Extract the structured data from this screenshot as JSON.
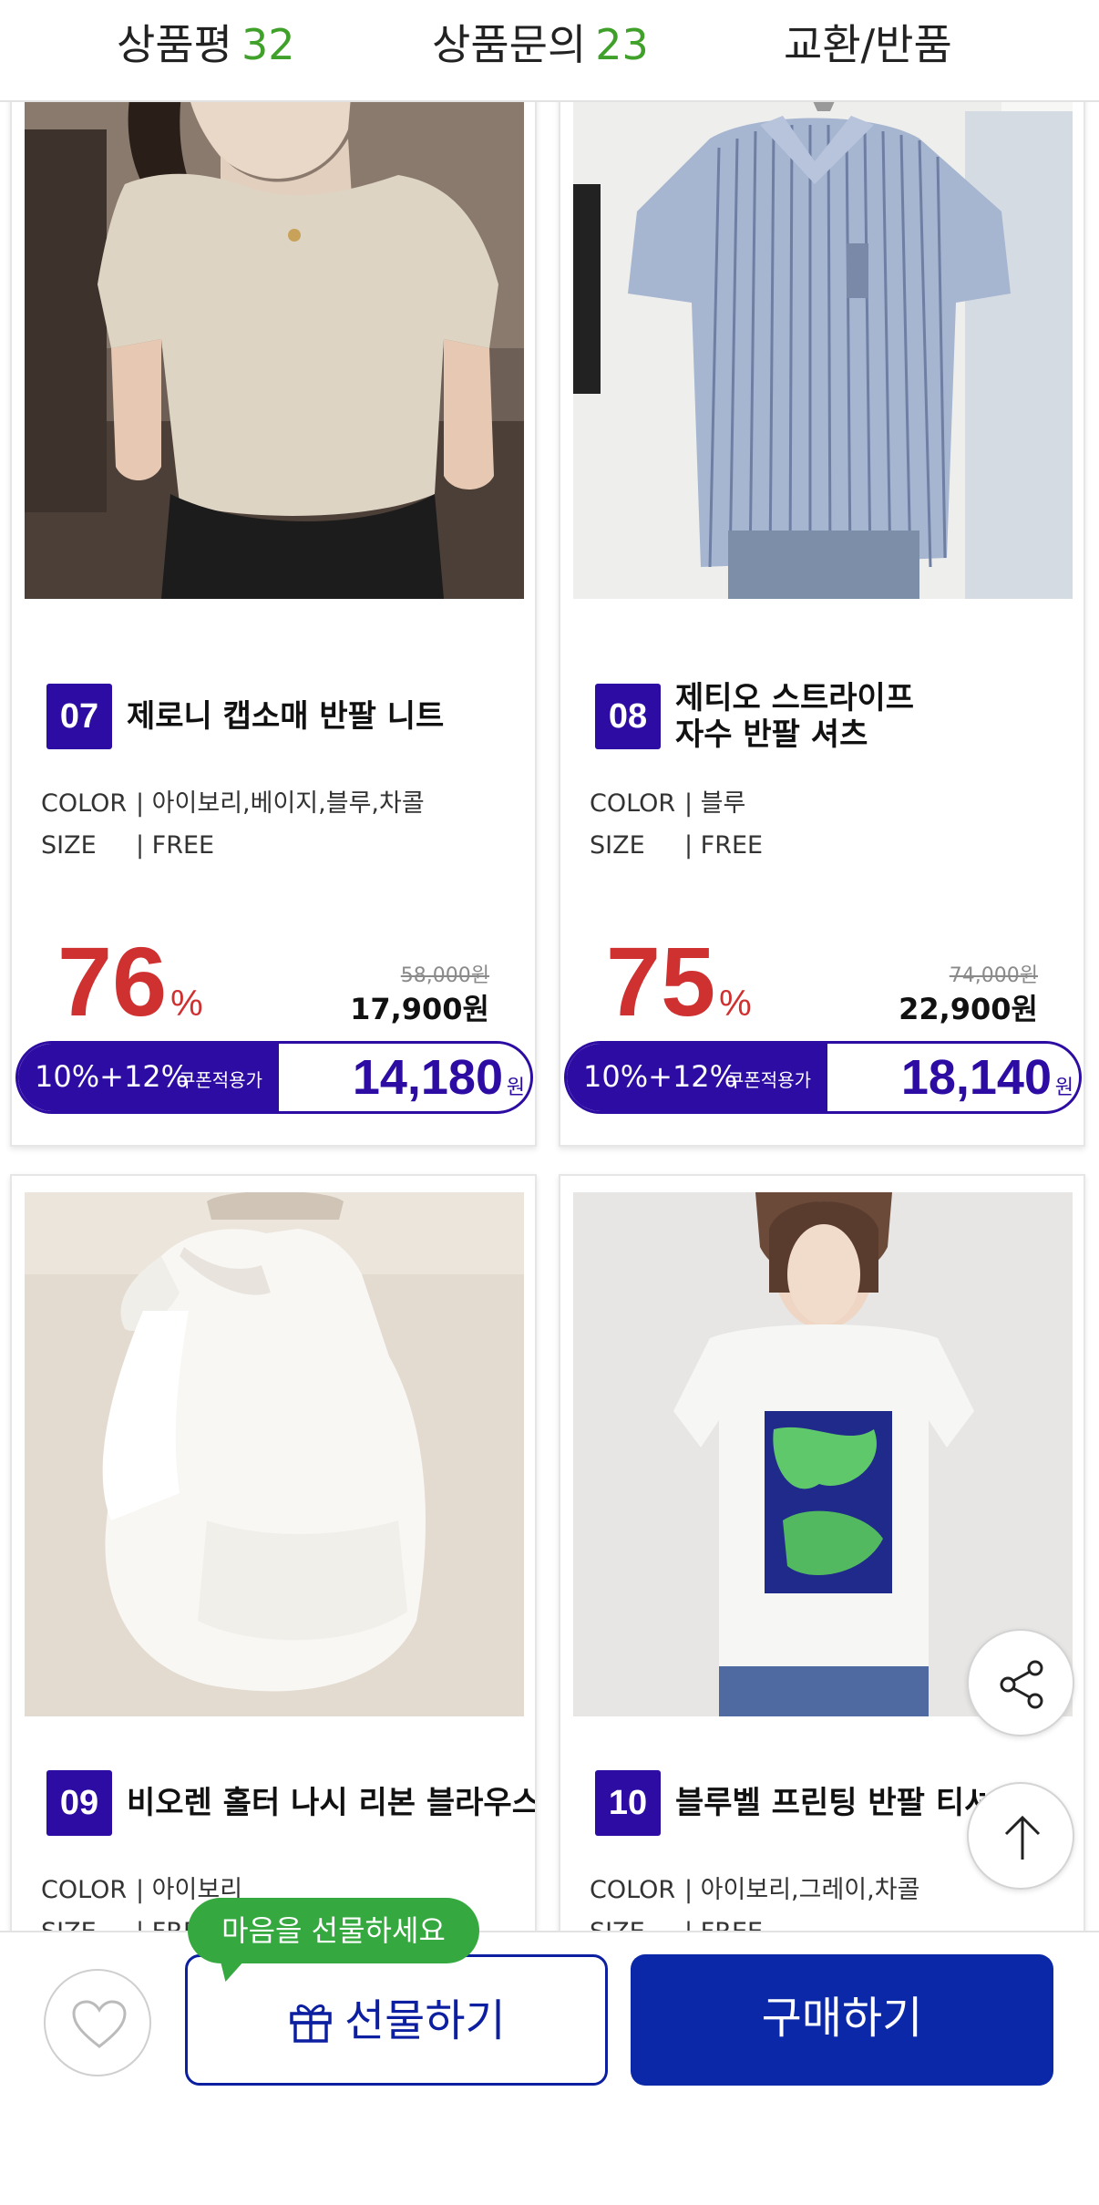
{
  "tabs": [
    {
      "label": "상품평",
      "count": "32"
    },
    {
      "label": "상품문의",
      "count": "23"
    },
    {
      "label": "교환/반품",
      "count": ""
    }
  ],
  "products": [
    {
      "rank": "07",
      "name": "제로니 캡소매 반팔 니트",
      "color_label": "COLOR",
      "color_value": "| 아이보리,베이지,블루,차콜",
      "size_label": "SIZE",
      "size_value": "| FREE",
      "discount": "76",
      "discount_unit": "%",
      "original_price": "58,000원",
      "sale_price": "17,900원",
      "coupon_rate": "10%+12%",
      "coupon_tag": "쿠폰적용가",
      "coupon_price": "14,180",
      "coupon_unit": "원",
      "image": "beige-knit-top-photo"
    },
    {
      "rank": "08",
      "name": "제티오 스트라이프\n자수 반팔 셔츠",
      "color_label": "COLOR",
      "color_value": "| 블루",
      "size_label": "SIZE",
      "size_value": "| FREE",
      "discount": "75",
      "discount_unit": "%",
      "original_price": "74,000원",
      "sale_price": "22,900원",
      "coupon_rate": "10%+12%",
      "coupon_tag": "쿠폰적용가",
      "coupon_price": "18,140",
      "coupon_unit": "원",
      "image": "blue-striped-shirt-photo"
    },
    {
      "rank": "09",
      "name": "비오렌 홀터 나시 리본 블라우스",
      "color_label": "COLOR",
      "color_value": "| 아이보리",
      "size_label": "SIZE",
      "size_value": "| FREE",
      "image": "white-halter-blouse-photo"
    },
    {
      "rank": "10",
      "name": "블루벨 프린팅 반팔 티셔츠",
      "color_label": "COLOR",
      "color_value": "| 아이보리,그레이,차콜",
      "size_label": "SIZE",
      "size_value": "| FREE",
      "image": "white-flower-print-tee-photo"
    }
  ],
  "floating": {
    "share_icon": "share-icon",
    "top_icon": "arrow-up-icon"
  },
  "bottom_bar": {
    "gift_bubble": "마음을 선물하세요",
    "gift_label": "선물하기",
    "buy_label": "구매하기",
    "like_icon": "heart-icon",
    "gift_icon": "gift-icon"
  },
  "colors": {
    "accent_purple": "#2d0ca3",
    "discount_red": "#cf3131",
    "tab_count_green": "#3fa02a",
    "buy_blue": "#0b28a8",
    "bubble_green": "#35a93f"
  }
}
